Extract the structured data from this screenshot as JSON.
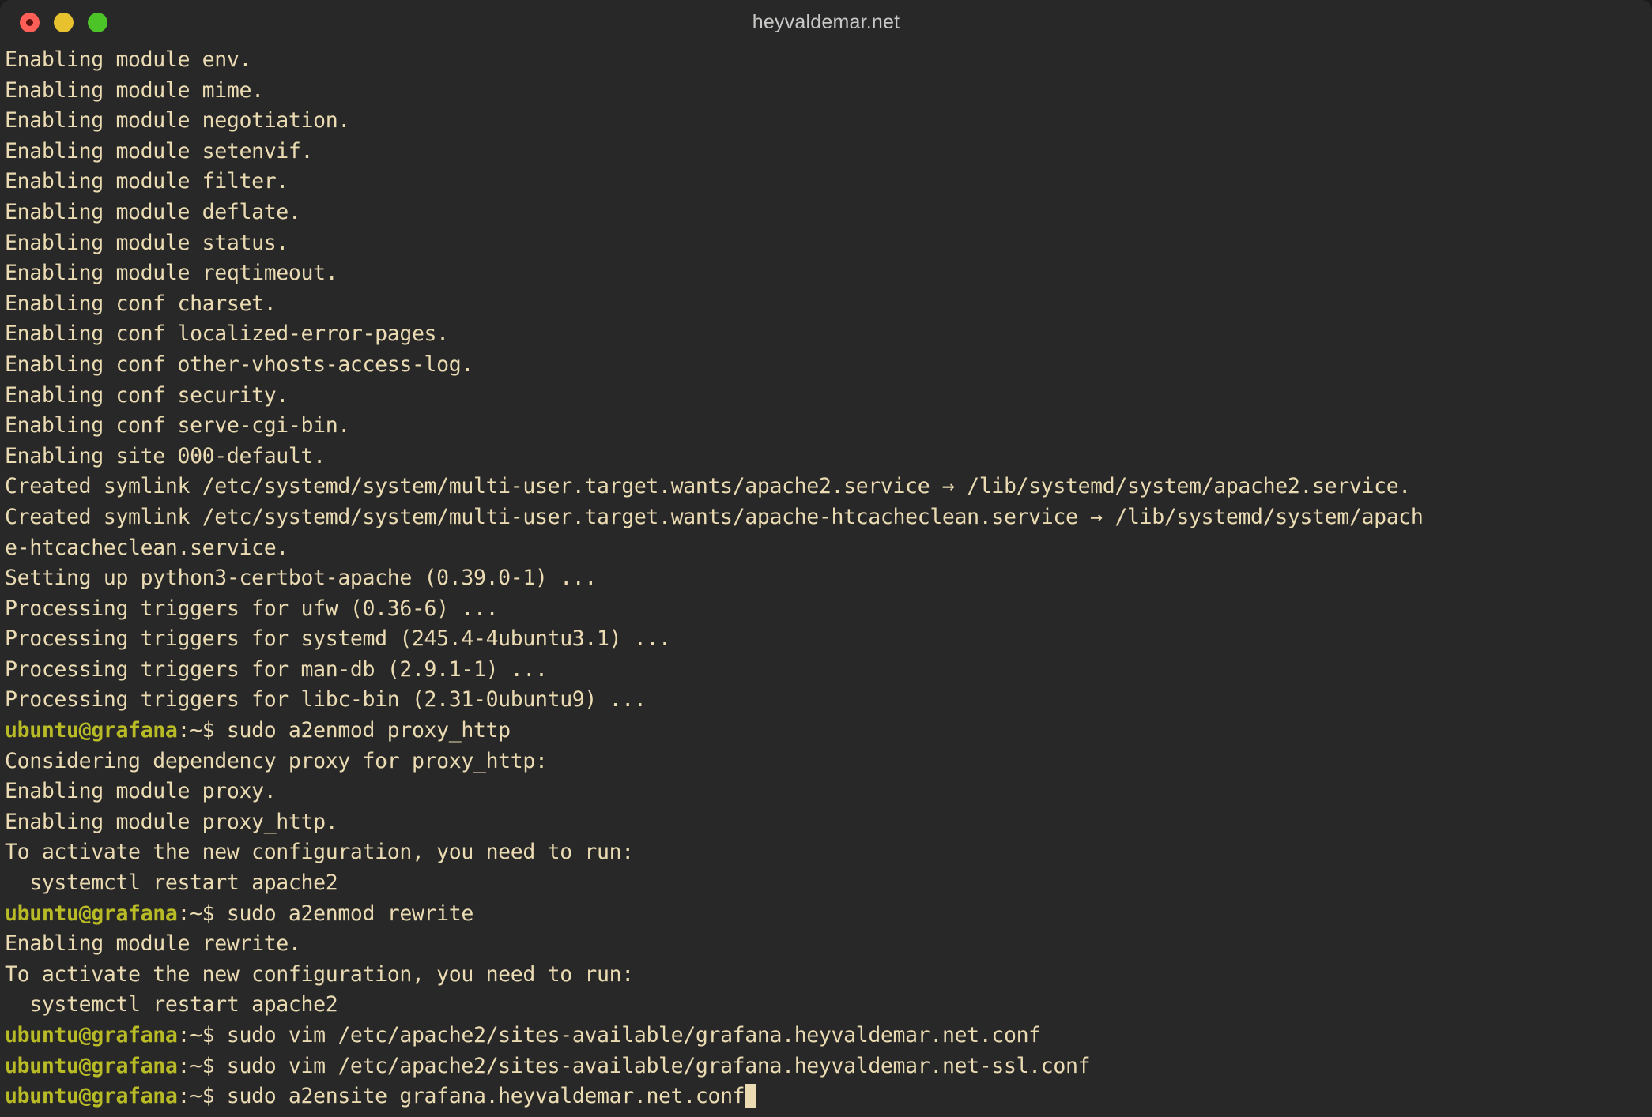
{
  "window": {
    "title": "heyvaldemar.net",
    "background_color": "#282828",
    "text_color": "#ebdbb2",
    "prompt_color": "#b8bb26",
    "controls": {
      "close_label": "close",
      "minimize_label": "minimize",
      "maximize_label": "maximize",
      "close_color": "#ff5f57",
      "minimize_color": "#e8c12f",
      "maximize_color": "#4cc326"
    }
  },
  "terminal": {
    "prompt_user_host": "ubuntu@grafana",
    "prompt_suffix": ":~$ ",
    "lines": [
      {
        "type": "output",
        "text": "Enabling module env."
      },
      {
        "type": "output",
        "text": "Enabling module mime."
      },
      {
        "type": "output",
        "text": "Enabling module negotiation."
      },
      {
        "type": "output",
        "text": "Enabling module setenvif."
      },
      {
        "type": "output",
        "text": "Enabling module filter."
      },
      {
        "type": "output",
        "text": "Enabling module deflate."
      },
      {
        "type": "output",
        "text": "Enabling module status."
      },
      {
        "type": "output",
        "text": "Enabling module reqtimeout."
      },
      {
        "type": "output",
        "text": "Enabling conf charset."
      },
      {
        "type": "output",
        "text": "Enabling conf localized-error-pages."
      },
      {
        "type": "output",
        "text": "Enabling conf other-vhosts-access-log."
      },
      {
        "type": "output",
        "text": "Enabling conf security."
      },
      {
        "type": "output",
        "text": "Enabling conf serve-cgi-bin."
      },
      {
        "type": "output",
        "text": "Enabling site 000-default."
      },
      {
        "type": "output",
        "text": "Created symlink /etc/systemd/system/multi-user.target.wants/apache2.service → /lib/systemd/system/apache2.service."
      },
      {
        "type": "output",
        "text": "Created symlink /etc/systemd/system/multi-user.target.wants/apache-htcacheclean.service → /lib/systemd/system/apach"
      },
      {
        "type": "output",
        "text": "e-htcacheclean.service."
      },
      {
        "type": "output",
        "text": "Setting up python3-certbot-apache (0.39.0-1) ..."
      },
      {
        "type": "output",
        "text": "Processing triggers for ufw (0.36-6) ..."
      },
      {
        "type": "output",
        "text": "Processing triggers for systemd (245.4-4ubuntu3.1) ..."
      },
      {
        "type": "output",
        "text": "Processing triggers for man-db (2.9.1-1) ..."
      },
      {
        "type": "output",
        "text": "Processing triggers for libc-bin (2.31-0ubuntu9) ..."
      },
      {
        "type": "prompt",
        "command": "sudo a2enmod proxy_http"
      },
      {
        "type": "output",
        "text": "Considering dependency proxy for proxy_http:"
      },
      {
        "type": "output",
        "text": "Enabling module proxy."
      },
      {
        "type": "output",
        "text": "Enabling module proxy_http."
      },
      {
        "type": "output",
        "text": "To activate the new configuration, you need to run:"
      },
      {
        "type": "output",
        "text": "  systemctl restart apache2"
      },
      {
        "type": "prompt",
        "command": "sudo a2enmod rewrite"
      },
      {
        "type": "output",
        "text": "Enabling module rewrite."
      },
      {
        "type": "output",
        "text": "To activate the new configuration, you need to run:"
      },
      {
        "type": "output",
        "text": "  systemctl restart apache2"
      },
      {
        "type": "prompt",
        "command": "sudo vim /etc/apache2/sites-available/grafana.heyvaldemar.net.conf"
      },
      {
        "type": "prompt",
        "command": "sudo vim /etc/apache2/sites-available/grafana.heyvaldemar.net-ssl.conf"
      },
      {
        "type": "prompt",
        "command": "sudo a2ensite grafana.heyvaldemar.net.conf",
        "cursor": true
      }
    ]
  }
}
